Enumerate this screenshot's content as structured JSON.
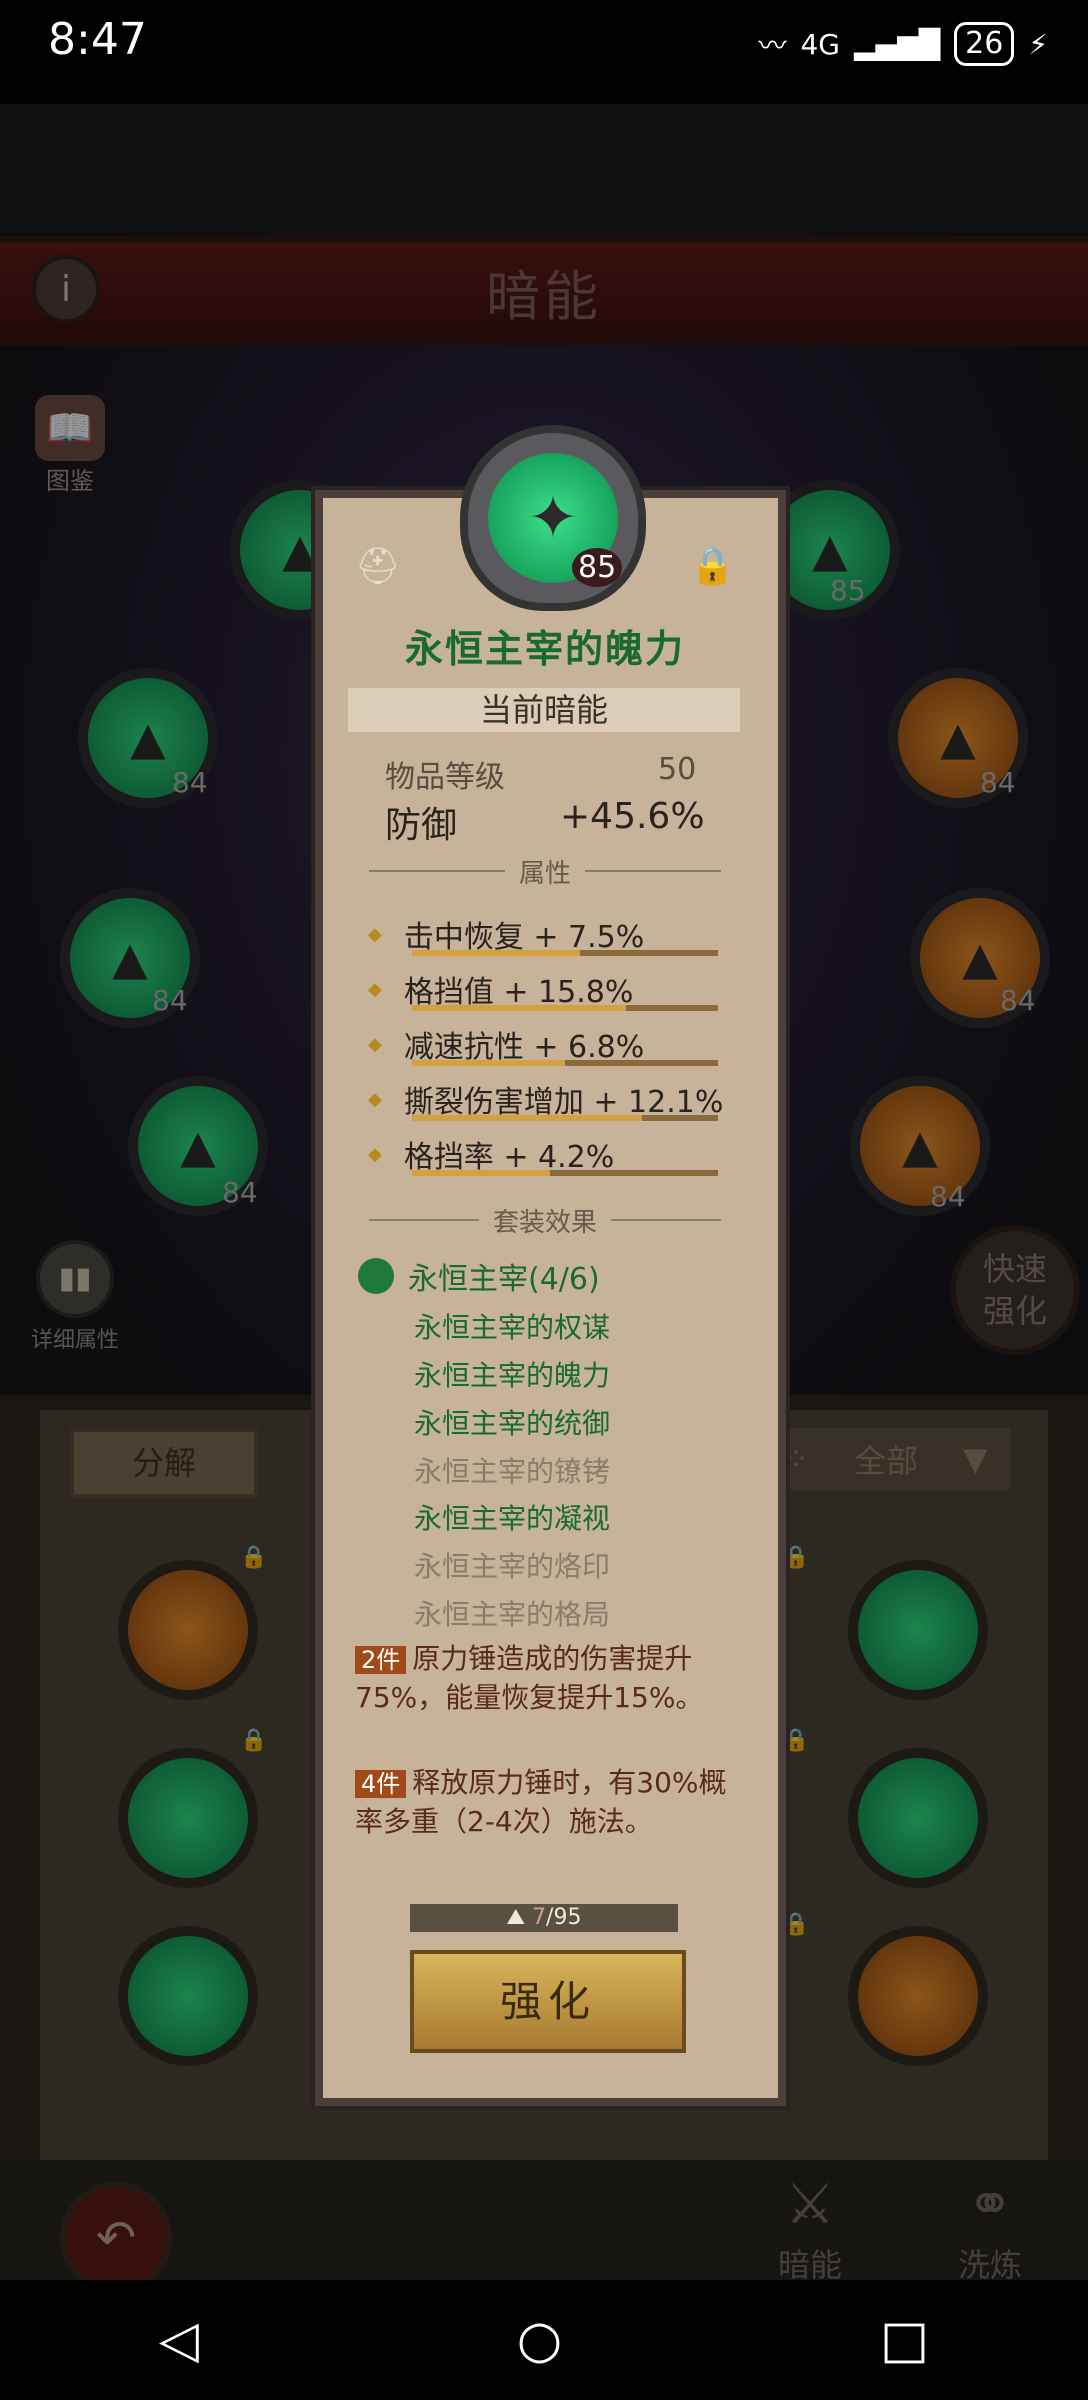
{
  "status_bar": {
    "time": "8:47",
    "network": "4G",
    "battery": "26"
  },
  "header": {
    "title": "暗能"
  },
  "side": {
    "codex_label": "图鉴",
    "detail_label": "详细属性",
    "quick_label": "快速强化"
  },
  "slots_left": [
    {
      "level": "84"
    },
    {
      "level": "84"
    },
    {
      "level": "84"
    }
  ],
  "slots_right": [
    {
      "level": "85"
    },
    {
      "level": "84"
    },
    {
      "level": "84"
    },
    {
      "level": "84"
    }
  ],
  "inventory": {
    "decompose_label": "分解",
    "filter_label": "全部"
  },
  "bottom_tabs": {
    "dark": "暗能",
    "wash": "洗炼"
  },
  "card": {
    "level": "85",
    "name": "永恒主宰的魄力",
    "current_label": "当前暗能",
    "item_level_label": "物品等级",
    "item_level_value": "50",
    "defense_label": "防御",
    "defense_value": "+45.6%",
    "attributes_header": "属性",
    "attributes": [
      {
        "text": "击中恢复 + 7.5%",
        "fill": 0.55
      },
      {
        "text": "格挡值 + 15.8%",
        "fill": 0.7
      },
      {
        "text": "减速抗性 + 6.8%",
        "fill": 0.5
      },
      {
        "text": "撕裂伤害增加 + 12.1%",
        "fill": 0.75
      },
      {
        "text": "格挡率 + 4.2%",
        "fill": 0.45
      }
    ],
    "set_header": "套装效果",
    "set_name": "永恒主宰(4/6)",
    "set_pieces": [
      {
        "name": "永恒主宰的权谋",
        "owned": true
      },
      {
        "name": "永恒主宰的魄力",
        "owned": true
      },
      {
        "name": "永恒主宰的统御",
        "owned": true
      },
      {
        "name": "永恒主宰的镣铐",
        "owned": false
      },
      {
        "name": "永恒主宰的凝视",
        "owned": true
      },
      {
        "name": "永恒主宰的烙印",
        "owned": false
      },
      {
        "name": "永恒主宰的格局",
        "owned": false
      }
    ],
    "bonus_2_tag": "2件",
    "bonus_2_text": "原力锤造成的伤害提升75%，能量恢复提升15%。",
    "bonus_4_tag": "4件",
    "bonus_4_text": "释放原力锤时，有30%概率多重（2-4次）施法。",
    "material_owned": "7",
    "material_total": "/95",
    "strengthen_label": "强化"
  },
  "colors": {
    "card_bg": "#c7b29a",
    "set_green": "#1a6a30",
    "banner_red": "#5a1a18"
  }
}
